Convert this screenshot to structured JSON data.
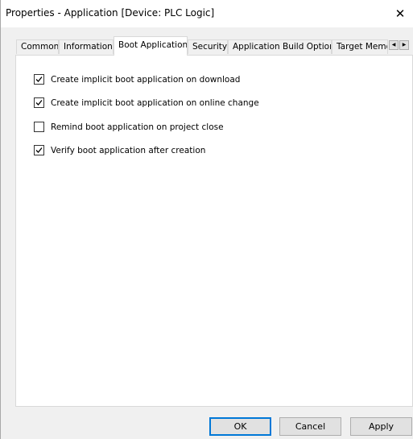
{
  "window": {
    "title": "Properties - Application [Device: PLC Logic]",
    "close_glyph": "✕"
  },
  "tabs": [
    {
      "label": "Common",
      "active": false
    },
    {
      "label": "Information",
      "active": false
    },
    {
      "label": "Boot Application",
      "active": true
    },
    {
      "label": "Security",
      "active": false
    },
    {
      "label": "Application Build Options",
      "active": false
    },
    {
      "label": "Target Memo",
      "active": false
    }
  ],
  "tab_scroll": {
    "left_glyph": "◀",
    "right_glyph": "▶"
  },
  "options": [
    {
      "label": "Create implicit boot application on download",
      "checked": true
    },
    {
      "label": "Create implicit boot application on online change",
      "checked": true
    },
    {
      "label": "Remind boot application on project close",
      "checked": false
    },
    {
      "label": "Verify boot application after creation",
      "checked": true
    }
  ],
  "buttons": {
    "ok": "OK",
    "cancel": "Cancel",
    "apply": "Apply"
  },
  "colors": {
    "accent": "#0078d7",
    "dialog_background": "#f0f0f0",
    "panel_background": "#ffffff"
  }
}
